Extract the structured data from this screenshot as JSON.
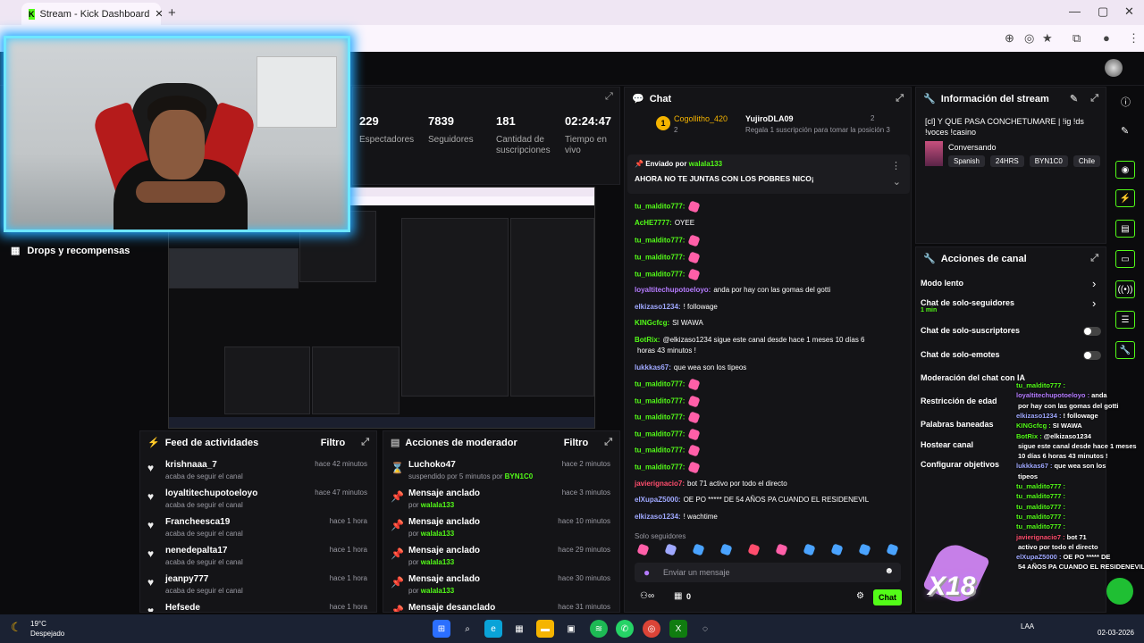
{
  "browser": {
    "tab_title": "Stream - Kick Dashboard",
    "new_tab": "+",
    "window_controls": [
      "—",
      "▢",
      "✕"
    ]
  },
  "stats": [
    {
      "value": "229",
      "label": "Espectadores"
    },
    {
      "value": "7839",
      "label": "Seguidores"
    },
    {
      "value": "181",
      "label": "Cantidad de suscripciones"
    },
    {
      "value": "02:24:47",
      "label": "Tiempo en vivo"
    }
  ],
  "sidebar": {
    "drops_label": "Drops y recompensas"
  },
  "feed": {
    "title": "Feed de actividades",
    "filter": "Filtro",
    "items": [
      {
        "name": "krishnaaa_7",
        "sub": "acaba de seguir el canal",
        "time": "hace 42 minutos"
      },
      {
        "name": "loyaltitechupotoeloyo",
        "sub": "acaba de seguir el canal",
        "time": "hace 47 minutos"
      },
      {
        "name": "Francheesca19",
        "sub": "acaba de seguir el canal",
        "time": "hace 1 hora"
      },
      {
        "name": "nenedepalta17",
        "sub": "acaba de seguir el canal",
        "time": "hace 1 hora"
      },
      {
        "name": "jeanpy777",
        "sub": "acaba de seguir el canal",
        "time": "hace 1 hora"
      },
      {
        "name": "Hefsede",
        "sub": "",
        "time": "hace 1 hora"
      }
    ]
  },
  "mod": {
    "title": "Acciones de moderador",
    "filter": "Filtro",
    "items": [
      {
        "name": "Luchoko47",
        "sub": "suspendido por 5 minutos por",
        "by": "BYN1C0",
        "time": "hace 2 minutos"
      },
      {
        "name": "Mensaje anclado",
        "sub": "por",
        "by": "walala133",
        "time": "hace 3 minutos"
      },
      {
        "name": "Mensaje anclado",
        "sub": "por",
        "by": "walala133",
        "time": "hace 10 minutos"
      },
      {
        "name": "Mensaje anclado",
        "sub": "por",
        "by": "walala133",
        "time": "hace 29 minutos"
      },
      {
        "name": "Mensaje anclado",
        "sub": "por",
        "by": "walala133",
        "time": "hace 30 minutos"
      },
      {
        "name": "Mensaje desanclado",
        "sub": "",
        "by": "",
        "time": "hace 31 minutos"
      }
    ]
  },
  "chat": {
    "title": "Chat",
    "top_gifter_1": {
      "name": "Cogollitho_420",
      "count": "2",
      "rank": "1"
    },
    "top_gifter_2": {
      "name": "YujiroDLA09",
      "count": "2"
    },
    "gift_note": "Regala 1 suscripción para tomar la posición 3",
    "pinned_by_label": "Enviado por",
    "pinned_by": "walala133",
    "pinned_text": "AHORA NO TE JUNTAS CON LOS POBRES NICO¡",
    "messages": [
      {
        "user": "tu_maldito777:",
        "text": "",
        "color": "#53fc18",
        "emote": true
      },
      {
        "user": "AcHE7777:",
        "text": "OYEE",
        "color": "#53fc18",
        "emote": false
      },
      {
        "user": "tu_maldito777:",
        "text": "",
        "color": "#53fc18",
        "emote": true
      },
      {
        "user": "tu_maldito777:",
        "text": "",
        "color": "#53fc18",
        "emote": true
      },
      {
        "user": "tu_maldito777:",
        "text": "",
        "color": "#53fc18",
        "emote": true
      },
      {
        "user": "loyaltitechupotoeloyo:",
        "text": "anda por hay con las gomas del gotti",
        "color": "#b57bff",
        "emote": false
      },
      {
        "user": "elkizaso1234:",
        "text": "! followage",
        "color": "#9fa8ff",
        "emote": false
      },
      {
        "user": "KINGcfcg:",
        "text": "SI WAWA",
        "color": "#53fc18",
        "emote": false
      },
      {
        "user": "BotRix:",
        "text": "@elkizaso1234 sigue este canal desde hace 1 meses 10 días 6",
        "color": "#53fc18",
        "emote": false
      },
      {
        "user": "",
        "text": "horas 43 minutos !",
        "color": "#fff",
        "emote": false
      },
      {
        "user": "lukkkas67:",
        "text": "que wea son los tipeos",
        "color": "#9fa8ff",
        "emote": false
      },
      {
        "user": "tu_maldito777:",
        "text": "",
        "color": "#53fc18",
        "emote": true
      },
      {
        "user": "tu_maldito777:",
        "text": "",
        "color": "#53fc18",
        "emote": true
      },
      {
        "user": "tu_maldito777:",
        "text": "",
        "color": "#53fc18",
        "emote": true
      },
      {
        "user": "tu_maldito777:",
        "text": "",
        "color": "#53fc18",
        "emote": true
      },
      {
        "user": "tu_maldito777:",
        "text": "",
        "color": "#53fc18",
        "emote": true
      },
      {
        "user": "tu_maldito777:",
        "text": "",
        "color": "#53fc18",
        "emote": true
      },
      {
        "user": "javierignacio7:",
        "text": "bot 71 activo por todo el directo",
        "color": "#ff4d6d",
        "emote": false
      },
      {
        "user": "elXupaZ5000:",
        "text": "OE PO ***** DE 54 AÑOS PA CUANDO EL RESIDENEVIL",
        "color": "#9fa8ff",
        "emote": false
      },
      {
        "user": "elkizaso1234:",
        "text": "! wachtime",
        "color": "#9fa8ff",
        "emote": false
      }
    ],
    "mode_label": "Solo seguidores",
    "input_placeholder": "Enviar un mensaje",
    "count": "0",
    "send_label": "Chat"
  },
  "stream_info": {
    "title": "Información del stream",
    "stream_title": "[cl] Y QUE PASA CONCHETUMARE | !ig !ds !voces !casino",
    "category": "Conversando",
    "tags": [
      "Spanish",
      "24HRS",
      "BYN1C0",
      "Chile"
    ]
  },
  "channel_actions": {
    "title": "Acciones de canal",
    "items": [
      {
        "label": "Modo lento",
        "sub": "",
        "control": "chevron"
      },
      {
        "label": "Chat de solo-seguidores",
        "sub": "1 min",
        "control": "chevron"
      },
      {
        "label": "Chat de solo-suscriptores",
        "sub": "",
        "control": "toggle"
      },
      {
        "label": "Chat de solo-emotes",
        "sub": "",
        "control": "toggle"
      },
      {
        "label": "Moderación del chat con IA",
        "sub": "",
        "control": ""
      },
      {
        "label": "Restricción de edad",
        "sub": "",
        "control": ""
      },
      {
        "label": "Palabras baneadas",
        "sub": "",
        "control": ""
      },
      {
        "label": "Hostear canal",
        "sub": "",
        "control": ""
      },
      {
        "label": "Configurar objetivos",
        "sub": "",
        "control": ""
      }
    ]
  },
  "overlay_chat": [
    {
      "user": "tu_maldito777 :",
      "text": "",
      "color": "#53fc18"
    },
    {
      "user": "loyaltitechupotoeloyo :",
      "text": "anda",
      "color": "#b57bff"
    },
    {
      "user": "",
      "text": "por hay con las gomas del gotti",
      "color": "#fff"
    },
    {
      "user": "elkizaso1234 :",
      "text": "! followage",
      "color": "#9fa8ff"
    },
    {
      "user": "KINGcfcg :",
      "text": "SI WAWA",
      "color": "#53fc18"
    },
    {
      "user": "BotRix :",
      "text": "@elkizaso1234",
      "color": "#53fc18"
    },
    {
      "user": "",
      "text": "sigue este canal desde hace 1 meses",
      "color": "#fff"
    },
    {
      "user": "",
      "text": "10 días 6 horas 43 minutos !",
      "color": "#fff"
    },
    {
      "user": "lukkkas67 :",
      "text": "que wea son los",
      "color": "#9fa8ff"
    },
    {
      "user": "",
      "text": "tipeos",
      "color": "#fff"
    },
    {
      "user": "tu_maldito777 :",
      "text": "",
      "color": "#53fc18"
    },
    {
      "user": "tu_maldito777 :",
      "text": "",
      "color": "#53fc18"
    },
    {
      "user": "tu_maldito777 :",
      "text": "",
      "color": "#53fc18"
    },
    {
      "user": "tu_maldito777 :",
      "text": "",
      "color": "#53fc18"
    },
    {
      "user": "tu_maldito777 :",
      "text": "",
      "color": "#53fc18"
    },
    {
      "user": "javierignacio7 :",
      "text": "bot 71",
      "color": "#ff4d6d"
    },
    {
      "user": "",
      "text": "activo por todo el directo",
      "color": "#fff"
    },
    {
      "user": "elXupaZ5000 :",
      "text": "OE PO ***** DE",
      "color": "#9fa8ff"
    },
    {
      "user": "",
      "text": "54 AÑOS PA CUANDO EL RESIDENEVIL",
      "color": "#fff"
    }
  ],
  "overlay_badge": "X18",
  "taskbar": {
    "temperature": "19°C",
    "weather": "Despejado",
    "lang": "LAA",
    "date": "02-03-2026"
  },
  "colors": {
    "accent": "#53fc18",
    "cam_glow": "#24a8ff"
  }
}
